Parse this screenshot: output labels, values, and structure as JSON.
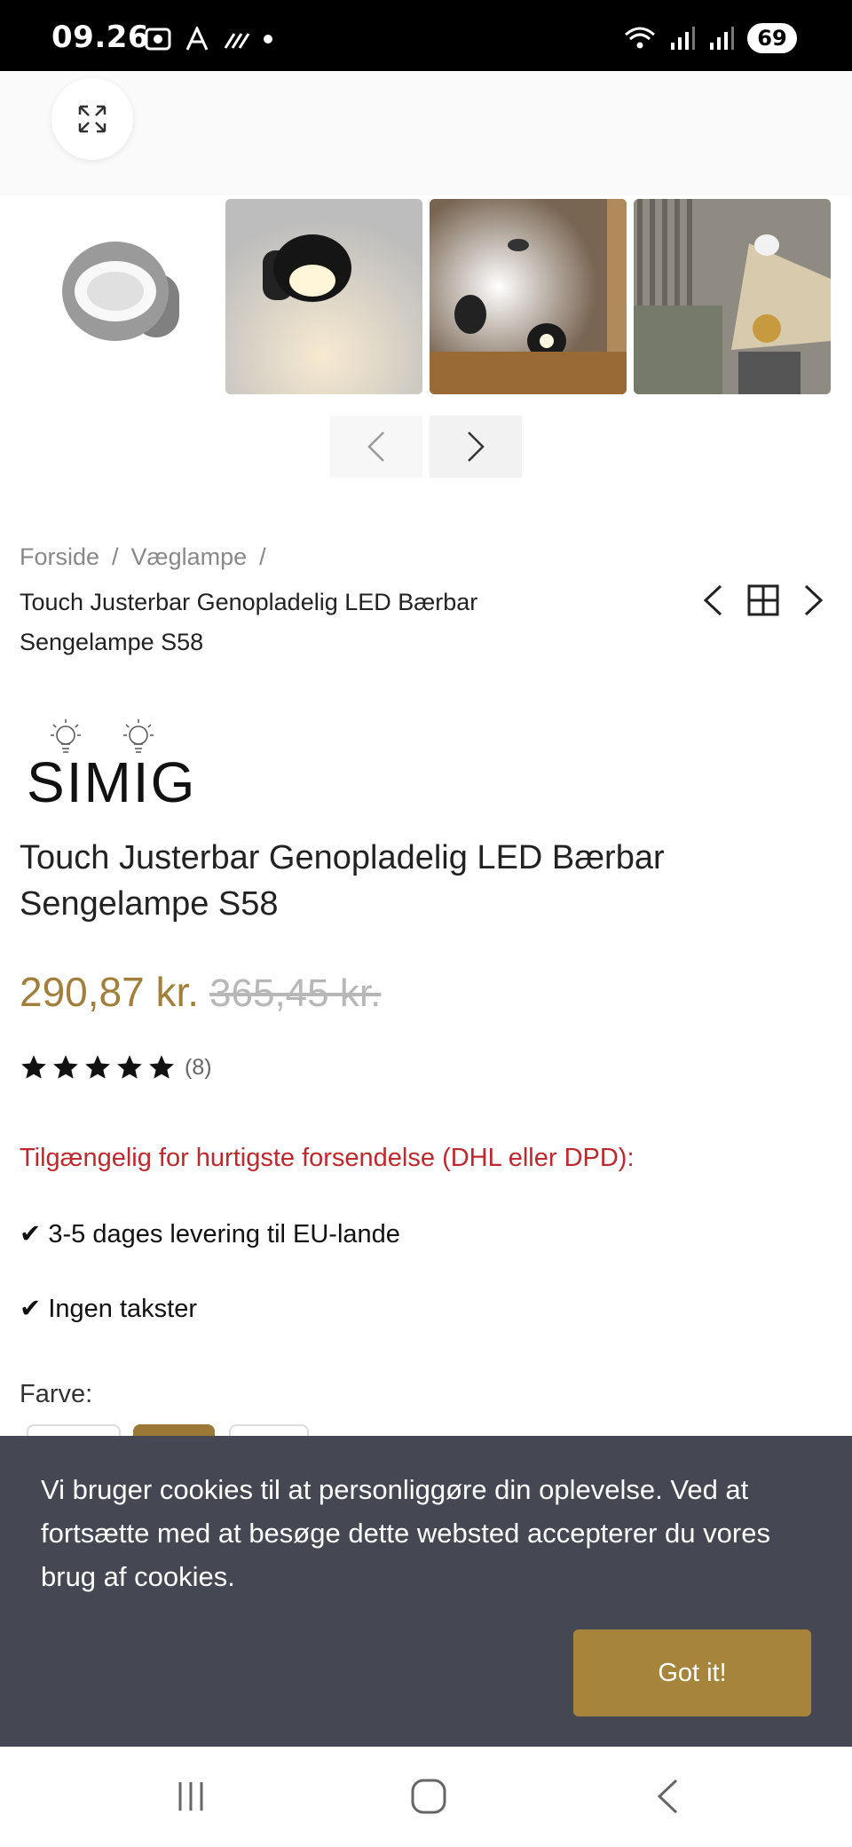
{
  "status_bar": {
    "time": "09.26",
    "battery": "69"
  },
  "breadcrumb": {
    "home": "Forside",
    "category": "Væglampe",
    "separator": "/",
    "current": "Touch Justerbar Genopladelig LED Bærbar Sengelampe S58"
  },
  "brand": {
    "name": "SIMIG"
  },
  "product": {
    "title": "Touch Justerbar Genopladelig LED Bærbar Sengelampe S58",
    "price_sale": "290,87 kr.",
    "price_old": "365,45 kr.",
    "rating_stars": 5,
    "rating_count": "(8)",
    "availability": "Tilgængelig for hurtigste forsendelse (DHL eller DPD):",
    "bullet_1": "✔ 3-5 dages levering til EU-lande",
    "bullet_2": "✔ Ingen takster",
    "color_label": "Farve:"
  },
  "cookie_banner": {
    "text": "Vi bruger cookies til at personliggøre din oplevelse. Ved at fortsætte med at besøge dette websted accepterer du vores brug af cookies.",
    "button": "Got it!"
  },
  "colors": {
    "accent": "#a6843c",
    "price": "#a37f3c",
    "availability": "#c0282b",
    "banner": "#454852"
  }
}
